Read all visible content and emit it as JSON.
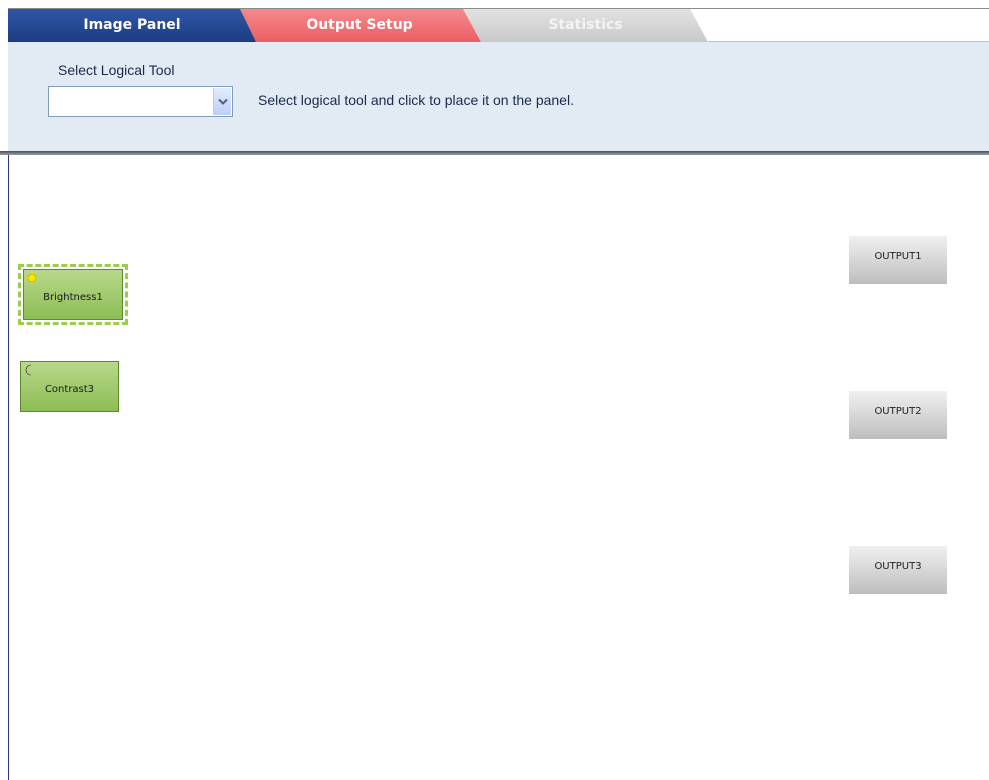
{
  "tabs": [
    {
      "label": "Image Panel",
      "active": true,
      "color": "#2f57a7"
    },
    {
      "label": "Output Setup",
      "active": false,
      "color": "#ea5f63"
    },
    {
      "label": "Statistics",
      "active": false,
      "color": "#c9c9c9"
    }
  ],
  "toolbar": {
    "select_label": "Select Logical Tool",
    "select_value": "",
    "hint": "Select logical tool and click to place it on the panel."
  },
  "tools": [
    {
      "label": "Brightness1",
      "icon": "sun-icon",
      "selected": true
    },
    {
      "label": "Contrast3",
      "icon": "moon-icon",
      "selected": false
    }
  ],
  "outputs": [
    {
      "label": "OUTPUT1"
    },
    {
      "label": "OUTPUT2"
    },
    {
      "label": "OUTPUT3"
    }
  ],
  "colors": {
    "tool_green": "#8dbd55",
    "selection_dash": "#9acd4a",
    "toolbar_bg": "#e2eaf3"
  }
}
